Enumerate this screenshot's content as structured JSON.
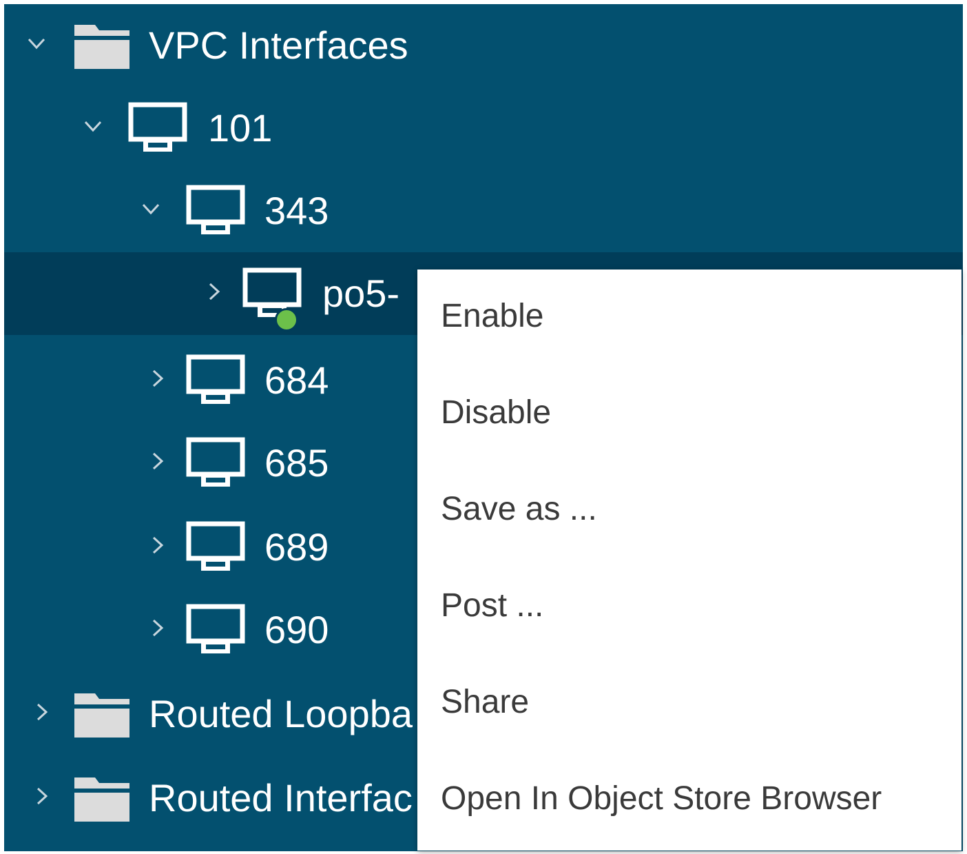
{
  "tree": {
    "items": [
      {
        "label": "VPC Interfaces",
        "icon": "folder-icon",
        "expander": "expanded"
      },
      {
        "label": "101",
        "icon": "port-icon",
        "expander": "expanded"
      },
      {
        "label": "343",
        "icon": "port-icon",
        "expander": "expanded"
      },
      {
        "label": "po5-",
        "icon": "port-icon",
        "expander": "collapsed",
        "selected": true,
        "status": "up",
        "status_color": "#6cc04a"
      },
      {
        "label": "684",
        "icon": "port-icon",
        "expander": "collapsed"
      },
      {
        "label": "685",
        "icon": "port-icon",
        "expander": "collapsed"
      },
      {
        "label": "689",
        "icon": "port-icon",
        "expander": "collapsed"
      },
      {
        "label": "690",
        "icon": "port-icon",
        "expander": "collapsed"
      },
      {
        "label": "Routed Loopba",
        "icon": "folder-icon",
        "expander": "collapsed"
      },
      {
        "label": "Routed Interfac",
        "icon": "folder-icon",
        "expander": "collapsed"
      }
    ]
  },
  "context_menu": {
    "items": [
      {
        "label": "Enable"
      },
      {
        "label": "Disable"
      },
      {
        "label": "Save as ..."
      },
      {
        "label": "Post ..."
      },
      {
        "label": "Share"
      },
      {
        "label": "Open In Object Store Browser"
      }
    ]
  },
  "colors": {
    "panel_bg": "#03506f",
    "selected_row_bg": "#013d59",
    "menu_bg": "#ffffff",
    "menu_text": "#3a3a3a",
    "status_up": "#6cc04a"
  }
}
